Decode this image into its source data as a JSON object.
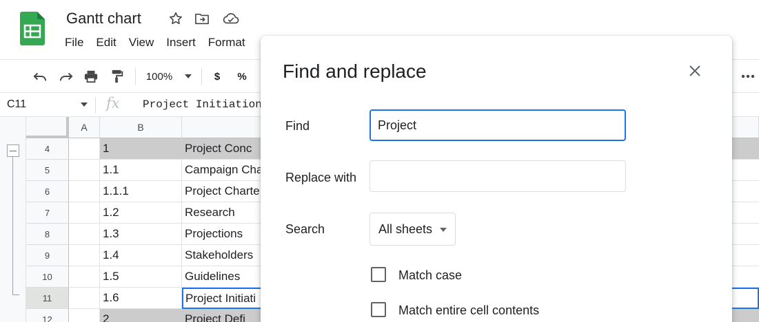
{
  "app": {
    "title": "Gantt chart",
    "icons": [
      "sheets-logo",
      "star-icon",
      "move-folder-icon",
      "cloud-status-icon"
    ]
  },
  "menu": [
    "File",
    "Edit",
    "View",
    "Insert",
    "Format"
  ],
  "toolbar": {
    "zoom": "100%",
    "currency": "$",
    "percent": "%",
    "icons": [
      "undo-icon",
      "redo-icon",
      "print-icon",
      "paint-format-icon",
      "chevron-down-icon",
      "more-icon"
    ]
  },
  "formula_bar": {
    "cell_ref": "C11",
    "fx": "fx",
    "content": "Project Initiation"
  },
  "grid": {
    "columns": [
      "A",
      "B"
    ],
    "rows": [
      {
        "num": "4",
        "b": "1",
        "c": "Project Conc",
        "highlight": true
      },
      {
        "num": "5",
        "b": "1.1",
        "c": "Campaign Cha"
      },
      {
        "num": "6",
        "b": "1.1.1",
        "c": "Project Charte"
      },
      {
        "num": "7",
        "b": "1.2",
        "c": "Research"
      },
      {
        "num": "8",
        "b": "1.3",
        "c": "Projections"
      },
      {
        "num": "9",
        "b": "1.4",
        "c": "Stakeholders"
      },
      {
        "num": "10",
        "b": "1.5",
        "c": "Guidelines"
      },
      {
        "num": "11",
        "b": "1.6",
        "c": "Project Initiati",
        "active": true
      },
      {
        "num": "12",
        "b": "2",
        "c": "Project Defi",
        "highlight": true
      }
    ]
  },
  "dialog": {
    "title": "Find and replace",
    "find_label": "Find",
    "find_value": "Project",
    "replace_label": "Replace with",
    "replace_value": "",
    "search_label": "Search",
    "search_value": "All sheets",
    "match_case_label": "Match case",
    "match_entire_label": "Match entire cell contents",
    "match_case_checked": false,
    "match_entire_checked": false
  },
  "colors": {
    "selection_blue": "#1a73e8",
    "sheets_green": "#34a853",
    "header_row_grey": "#cccccc"
  }
}
